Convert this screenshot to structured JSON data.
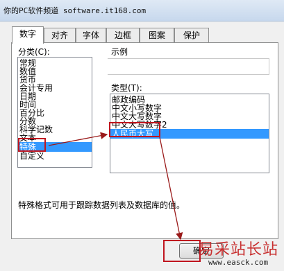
{
  "titlebar": {
    "text": "你的PC软件频道 software.it168.com"
  },
  "tabs": [
    {
      "label": "数字"
    },
    {
      "label": "对齐"
    },
    {
      "label": "字体"
    },
    {
      "label": "边框"
    },
    {
      "label": "图案"
    },
    {
      "label": "保护"
    }
  ],
  "category": {
    "label": "分类(C):",
    "items": [
      "常规",
      "数值",
      "货币",
      "会计专用",
      "日期",
      "时间",
      "百分比",
      "分数",
      "科学记数",
      "文本",
      "特殊",
      "自定义"
    ],
    "selected": "特殊"
  },
  "sample": {
    "label": "示例"
  },
  "type": {
    "label": "类型(T):",
    "items": [
      "邮政编码",
      "中文小写数字",
      "中文大写数字",
      "中文大写数字2",
      "人民币大写"
    ],
    "selected": "人民币大写"
  },
  "description": "特殊格式可用于跟踪数据列表及数据库的值。",
  "buttons": {
    "ok": "确定"
  },
  "watermark": {
    "text": "易采站长站",
    "url": "www.easck.com"
  },
  "colors": {
    "selection": "#3399ff",
    "highlight_box": "#c0151f",
    "arrow": "#9a1a1a"
  }
}
